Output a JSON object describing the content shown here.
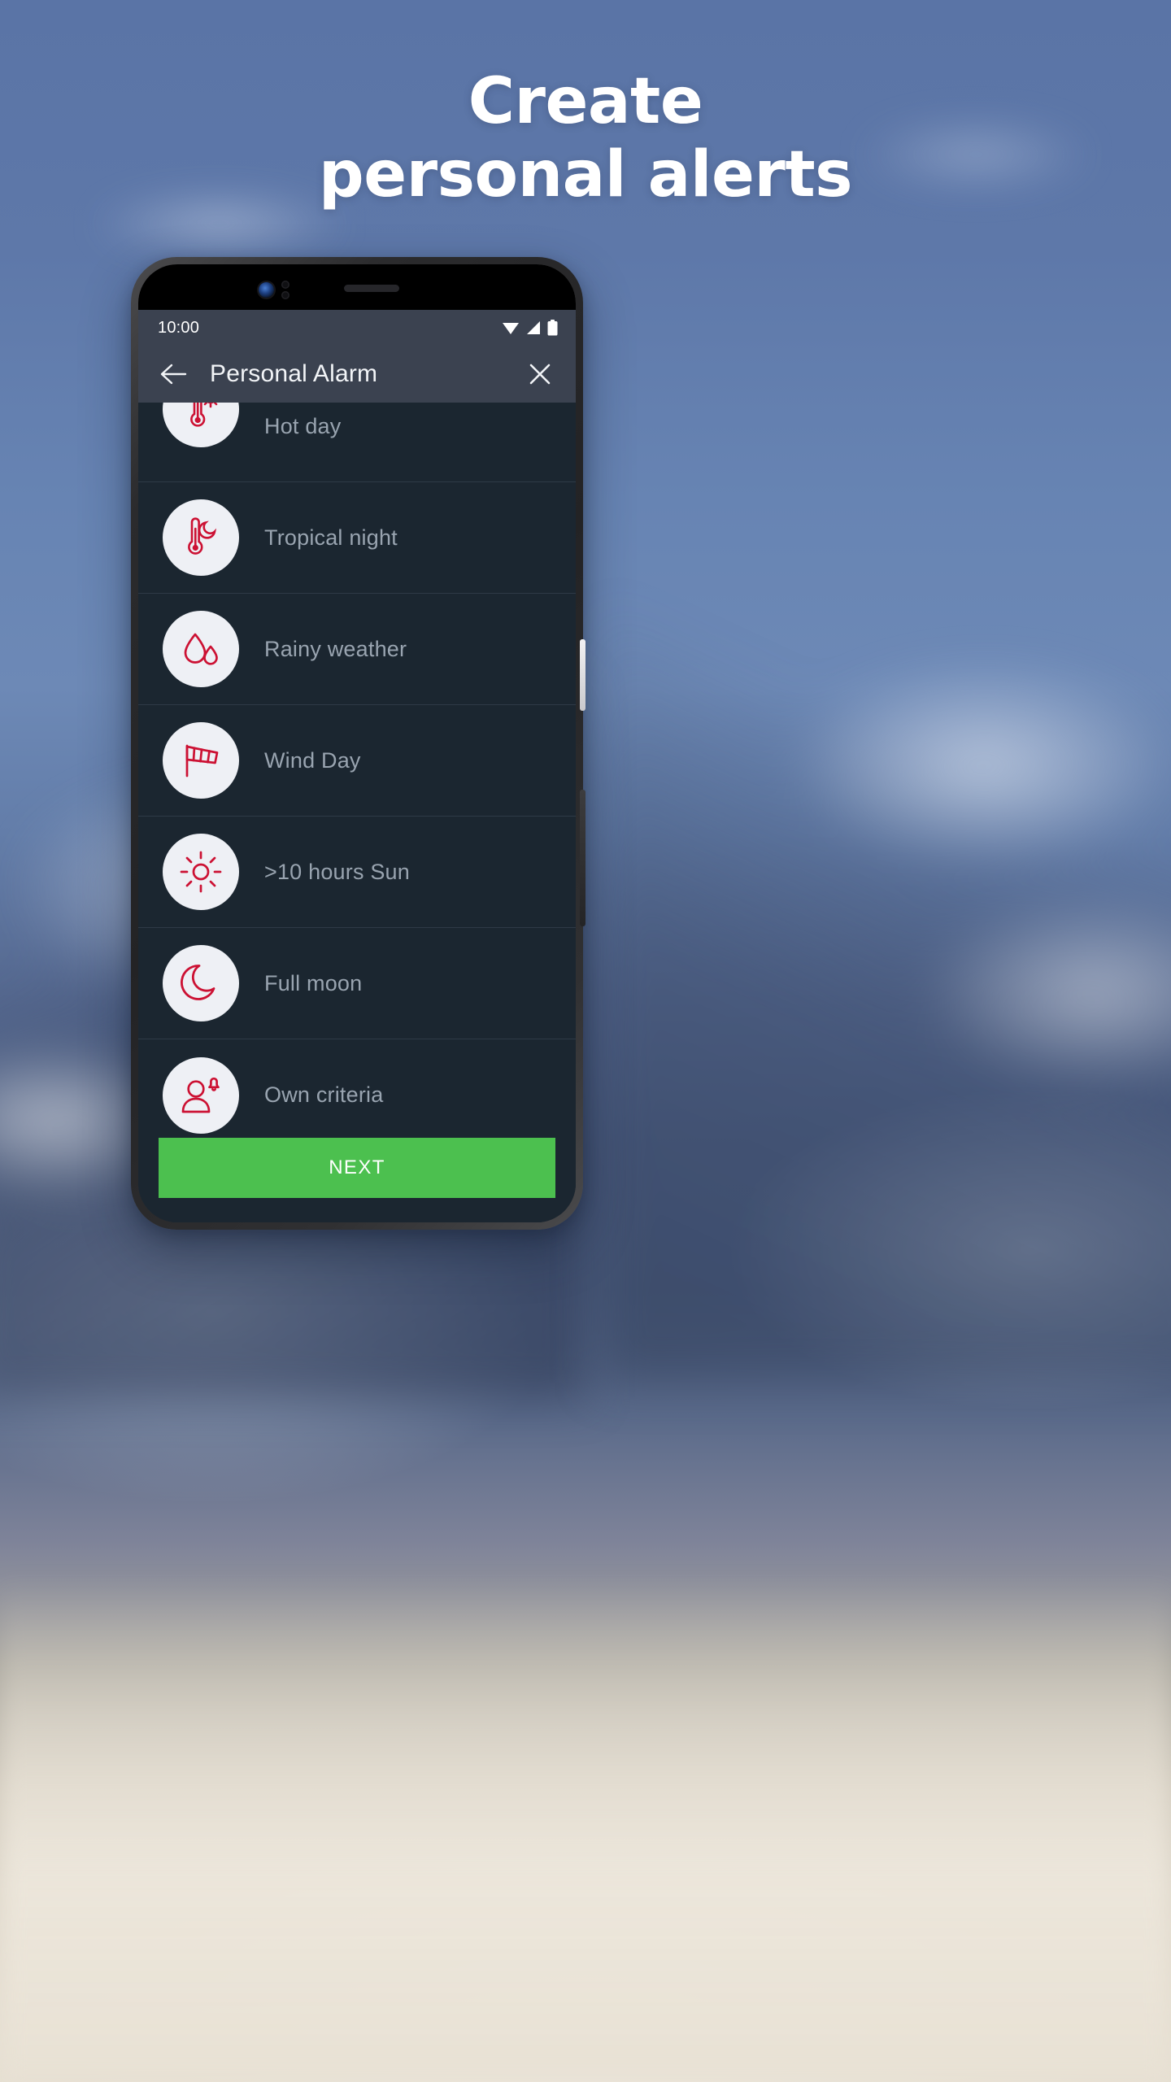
{
  "headline": {
    "line1": "Create",
    "line2": "personal alerts"
  },
  "phone": {
    "status_bar": {
      "time": "10:00",
      "icons": [
        "wifi-icon",
        "cellular-signal-icon",
        "battery-icon"
      ]
    },
    "app_bar": {
      "back_icon": "arrow-left-icon",
      "title": "Personal Alarm",
      "close_icon": "close-icon"
    },
    "list": {
      "items": [
        {
          "label": "Hot day",
          "icon": "thermometer-sun-icon"
        },
        {
          "label": "Tropical night",
          "icon": "thermometer-moon-icon"
        },
        {
          "label": "Rainy weather",
          "icon": "raindrops-icon"
        },
        {
          "label": "Wind Day",
          "icon": "windsock-icon"
        },
        {
          "label": ">10 hours Sun",
          "icon": "sun-icon"
        },
        {
          "label": "Full moon",
          "icon": "crescent-moon-icon"
        },
        {
          "label": "Own criteria",
          "icon": "person-bell-icon"
        }
      ]
    },
    "next_button": {
      "label": "NEXT"
    }
  },
  "colors": {
    "accent_red": "#cc1133",
    "next_green": "#4cc04f",
    "app_bar": "#3b4250",
    "screen_bg": "#1b2630",
    "label_text": "#99a4b0",
    "avatar_bg": "#eef0f5"
  }
}
